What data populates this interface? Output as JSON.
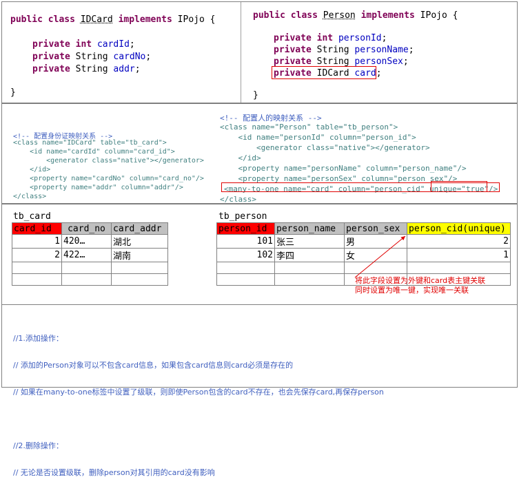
{
  "idcard_class": {
    "header": [
      "public",
      "class",
      "IDCard",
      "implements",
      "IPojo {"
    ],
    "fields": [
      {
        "mod": "private",
        "type": "int",
        "name": "cardId",
        "end": ";"
      },
      {
        "mod": "private",
        "type": "String",
        "name": "cardNo",
        "end": ";"
      },
      {
        "mod": "private",
        "type": "String",
        "name": "addr",
        "end": ";"
      }
    ],
    "close": "}"
  },
  "person_class": {
    "header": [
      "public",
      "class",
      "Person",
      "implements",
      "IPojo {"
    ],
    "fields": [
      {
        "mod": "private",
        "type": "int",
        "name": "personId",
        "end": ";"
      },
      {
        "mod": "private",
        "type": "String",
        "name": "personName",
        "end": ";"
      },
      {
        "mod": "private",
        "type": "String",
        "name": "personSex",
        "end": ";"
      },
      {
        "mod": "private",
        "type": "IDCard",
        "name": "card",
        "end": ";"
      }
    ],
    "close": "}"
  },
  "idcard_mapping": {
    "comment": "<!-- 配置身份证映射关系 -->",
    "lines": [
      "<class name=\"IDCard\" table=\"tb_card\">",
      "    <id name=\"cardId\" column=\"card_id\">",
      "        <generator class=\"native\"></generator>",
      "    </id>",
      "    <property name=\"cardNo\" column=\"card_no\"/>",
      "    <property name=\"addr\" column=\"addr\"/>",
      "</class>"
    ]
  },
  "person_mapping": {
    "comment": "<!-- 配置人的映射关系 -->",
    "lines": [
      "<class name=\"Person\" table=\"tb_person\">",
      "    <id name=\"personId\" column=\"person_id\">",
      "        <generator class=\"native\"></generator>",
      "    </id>",
      "    <property name=\"personName\" column=\"person_name\"/>",
      "    <property name=\"personSex\" column=\"person_sex\"/>",
      "<many-to-one name=\"card\" column=\"person_cid\" unique=\"true\"/>",
      "</class>"
    ]
  },
  "tb_card": {
    "title": "tb_card",
    "headers": [
      "card_id",
      "card_no",
      "card_addr"
    ],
    "rows": [
      [
        "1",
        "420…",
        "湖北"
      ],
      [
        "2",
        "422…",
        "湖南"
      ]
    ]
  },
  "tb_person": {
    "title": "tb_person",
    "headers": [
      "person_id",
      "person_name",
      "person_sex",
      "person_cid(unique)"
    ],
    "rows": [
      [
        "101",
        "张三",
        "男",
        "2"
      ],
      [
        "102",
        "李四",
        "女",
        "1"
      ]
    ]
  },
  "annotation": {
    "line1": "将此字段设置为外键和card表主键关联",
    "line2": "同时设置为唯一键，实现唯一关联",
    "color": "#e00000"
  },
  "operations": [
    "//1.添加操作：",
    "// 添加的Person对象可以不包含card信息，如果包含card信息则card必须是存在的",
    "// 如果在many-to-one标签中设置了级联，则即使Person包含的card不存在，也会先保存card,再保存person",
    "",
    "//2.删除操作：",
    "// 无论是否设置级联，删除person对其引用的card没有影响"
  ]
}
